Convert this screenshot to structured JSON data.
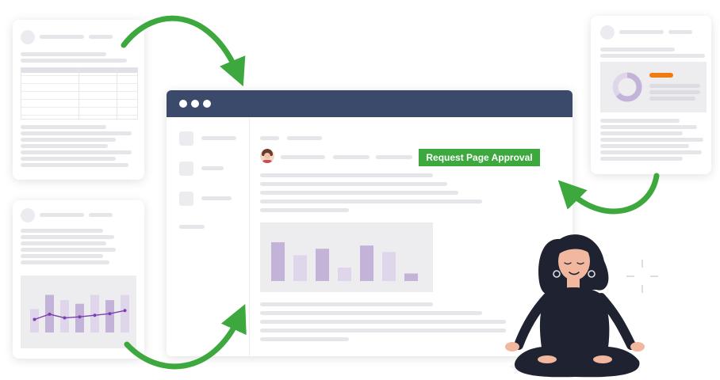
{
  "main_window": {
    "approval_button_label": "Request Page Approval"
  },
  "colors": {
    "browser_header": "#3b4a6b",
    "approval_button": "#3da83d",
    "arrow": "#3da83d",
    "bar_dark": "#c3b3d8",
    "bar_light": "#dfd6eb",
    "line_series": "#7b3fb0",
    "donut": "#c3b3d8",
    "tag_orange": "#f07b12"
  },
  "main_chart": {
    "type": "bar",
    "values": [
      0.72,
      0.48,
      0.6,
      0.25,
      0.66,
      0.54,
      0.14
    ],
    "shades": [
      "dark",
      "light",
      "dark",
      "light",
      "dark",
      "light",
      "dark"
    ]
  },
  "left_chart": {
    "bars": [
      0.45,
      0.72,
      0.62,
      0.55,
      0.72,
      0.62,
      0.72
    ],
    "shades": [
      "light",
      "dark",
      "light",
      "dark",
      "light",
      "dark",
      "light"
    ],
    "line": [
      0.25,
      0.35,
      0.28,
      0.3,
      0.33,
      0.36,
      0.42
    ]
  },
  "icons": {
    "avatar": "user-avatar-icon",
    "window_dots": "window-controls-icon",
    "sparkle": "sparkle-icon"
  }
}
